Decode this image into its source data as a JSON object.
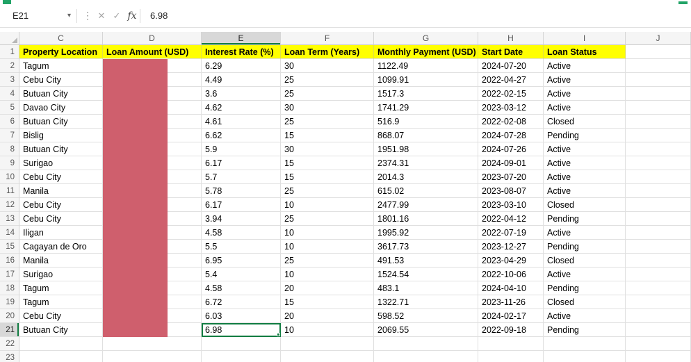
{
  "app": {
    "name_box": "E21",
    "formula_value": "6.98",
    "fx_label": "fx",
    "icons": {
      "chevron_down": "▾",
      "menu_dots": "⋮",
      "cancel": "✕",
      "enter": "✓"
    }
  },
  "grid": {
    "column_letters": [
      "C",
      "D",
      "E",
      "F",
      "G",
      "H",
      "I",
      "J"
    ],
    "row_count": 23,
    "selected_cell": {
      "column": "E",
      "row": 21,
      "ref": "E21"
    },
    "header_labels": [
      "Property Location",
      "Loan Amount (USD)",
      "Interest Rate (%)",
      "Loan Term (Years)",
      "Monthly Payment (USD)",
      "Start Date",
      "Loan Status"
    ],
    "rows": [
      [
        "Tagum",
        "",
        "6.29",
        "30",
        "1122.49",
        "2024-07-20",
        "Active"
      ],
      [
        "Cebu City",
        "",
        "4.49",
        "25",
        "1099.91",
        "2022-04-27",
        "Active"
      ],
      [
        "Butuan City",
        "",
        "3.6",
        "25",
        "1517.3",
        "2022-02-15",
        "Active"
      ],
      [
        "Davao City",
        "",
        "4.62",
        "30",
        "1741.29",
        "2023-03-12",
        "Active"
      ],
      [
        "Butuan City",
        "",
        "4.61",
        "25",
        "516.9",
        "2022-02-08",
        "Closed"
      ],
      [
        "Bislig",
        "",
        "6.62",
        "15",
        "868.07",
        "2024-07-28",
        "Pending"
      ],
      [
        "Butuan City",
        "",
        "5.9",
        "30",
        "1951.98",
        "2024-07-26",
        "Active"
      ],
      [
        "Surigao",
        "",
        "6.17",
        "15",
        "2374.31",
        "2024-09-01",
        "Active"
      ],
      [
        "Cebu City",
        "",
        "5.7",
        "15",
        "2014.3",
        "2023-07-20",
        "Active"
      ],
      [
        "Manila",
        "",
        "5.78",
        "25",
        "615.02",
        "2023-08-07",
        "Active"
      ],
      [
        "Cebu City",
        "",
        "6.17",
        "10",
        "2477.99",
        "2023-03-10",
        "Closed"
      ],
      [
        "Cebu City",
        "",
        "3.94",
        "25",
        "1801.16",
        "2022-04-12",
        "Pending"
      ],
      [
        "Iligan",
        "",
        "4.58",
        "10",
        "1995.92",
        "2022-07-19",
        "Active"
      ],
      [
        "Cagayan de Oro",
        "",
        "5.5",
        "10",
        "3617.73",
        "2023-12-27",
        "Pending"
      ],
      [
        "Manila",
        "",
        "6.95",
        "25",
        "491.53",
        "2023-04-29",
        "Closed"
      ],
      [
        "Surigao",
        "",
        "5.4",
        "10",
        "1524.54",
        "2022-10-06",
        "Active"
      ],
      [
        "Tagum",
        "",
        "4.58",
        "20",
        "483.1",
        "2024-04-10",
        "Pending"
      ],
      [
        "Tagum",
        "",
        "6.72",
        "15",
        "1322.71",
        "2023-11-26",
        "Closed"
      ],
      [
        "Cebu City",
        "",
        "6.03",
        "20",
        "598.52",
        "2024-02-17",
        "Active"
      ],
      [
        "Butuan City",
        "",
        "6.98",
        "10",
        "2069.55",
        "2022-09-18",
        "Pending"
      ]
    ],
    "redaction": {
      "column": "D",
      "from_row": 2,
      "to_row": 21,
      "color": "#cf5f6d"
    }
  },
  "colors": {
    "header_fill": "#ffff00",
    "selection_green": "#107c41",
    "accent_green": "#21a366"
  }
}
